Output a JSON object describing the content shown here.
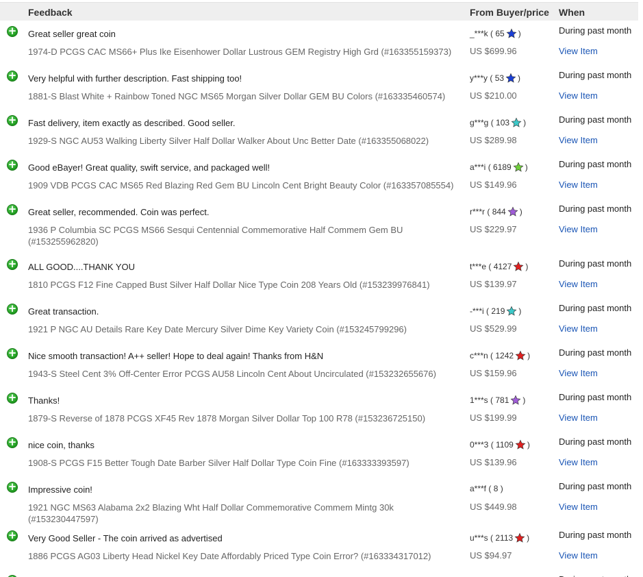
{
  "header": {
    "feedback": "Feedback",
    "buyer_price": "From Buyer/price",
    "when": "When"
  },
  "rows": [
    {
      "comment": "Great seller great coin",
      "item": "1974-D PCGS CAC MS66+ Plus Ike Eisenhower Dollar Lustrous GEM Registry High Grd (#163355159373)",
      "buyer": "_***k",
      "score": "65",
      "star_color": "#1a3fd6",
      "price": "US $699.96",
      "when": "During past month",
      "view": "View Item"
    },
    {
      "comment": "Very helpful with further description. Fast shipping too!",
      "item": "1881-S Blast White + Rainbow Toned NGC MS65 Morgan Silver Dollar GEM BU Colors (#163335460574)",
      "buyer": "y***y",
      "score": "53",
      "star_color": "#1a3fd6",
      "price": "US $210.00",
      "when": "During past month",
      "view": "View Item"
    },
    {
      "comment": "Fast delivery, item exactly as described. Good seller.",
      "item": "1929-S NGC AU53 Walking Liberty Silver Half Dollar Walker About Unc Better Date (#163355068022)",
      "buyer": "g***g",
      "score": "103",
      "star_color": "#3cc9c9",
      "price": "US $289.98",
      "when": "During past month",
      "view": "View Item"
    },
    {
      "comment": "Good eBayer! Great quality, swift service, and packaged well!",
      "item": "1909 VDB PCGS CAC MS65 Red Blazing Red Gem BU Lincoln Cent Bright Beauty Color (#163357085554)",
      "buyer": "a***i",
      "score": "6189",
      "star_color": "#6fcf3a",
      "price": "US $149.96",
      "when": "During past month",
      "view": "View Item"
    },
    {
      "comment": "Great seller, recommended. Coin was perfect.",
      "item": "1936 P Columbia SC PCGS MS66 Sesqui Centennial Commemorative Half Commem Gem BU (#153255962820)",
      "buyer": "r***r",
      "score": "844",
      "star_color": "#a05cd8",
      "price": "US $229.97",
      "when": "During past month",
      "view": "View Item"
    },
    {
      "comment": "ALL GOOD....THANK YOU",
      "item": "1810 PCGS F12 Fine Capped Bust Silver Half Dollar Nice Type Coin 208 Years Old (#153239976841)",
      "buyer": "t***e",
      "score": "4127",
      "star_color": "#e02020",
      "price": "US $139.97",
      "when": "During past month",
      "view": "View Item"
    },
    {
      "comment": "Great transaction.",
      "item": "1921 P NGC AU Details Rare Key Date Mercury Silver Dime Key Variety Coin (#153245799296)",
      "buyer": "-***i",
      "score": "219",
      "star_color": "#3cc9c9",
      "price": "US $529.99",
      "when": "During past month",
      "view": "View Item"
    },
    {
      "comment": "Nice smooth transaction! A++ seller! Hope to deal again! Thanks from H&N",
      "item": "1943-S Steel Cent 3% Off-Center Error PCGS AU58 Lincoln Cent About Uncirculated (#153232655676)",
      "buyer": "c***n",
      "score": "1242",
      "star_color": "#e02020",
      "price": "US $159.96",
      "when": "During past month",
      "view": "View Item"
    },
    {
      "comment": "Thanks!",
      "item": "1879-S Reverse of 1878 PCGS XF45 Rev 1878 Morgan Silver Dollar Top 100 R78 (#153236725150)",
      "buyer": "1***s",
      "score": "781",
      "star_color": "#a05cd8",
      "price": "US $199.99",
      "when": "During past month",
      "view": "View Item"
    },
    {
      "comment": "nice coin, thanks",
      "item": "1908-S PCGS F15 Better Tough Date Barber Silver Half Dollar Type Coin Fine (#163333393597)",
      "buyer": "0***3",
      "score": "1109",
      "star_color": "#e02020",
      "price": "US $139.96",
      "when": "During past month",
      "view": "View Item"
    },
    {
      "comment": "Impressive coin!",
      "item": "1921 NGC MS63 Alabama 2x2 Blazing Wht Half Dollar Commemorative Commem Mintg 30k (#153230447597)",
      "buyer": "a***f",
      "score": "8",
      "star_color": "",
      "price": "US $449.98",
      "when": "During past month",
      "view": "View Item"
    },
    {
      "comment": "Very Good Seller - The coin arrived as advertised",
      "item": "1886 PCGS AG03 Liberty Head Nickel Key Date Affordably Priced Type Coin Error? (#163334317012)",
      "buyer": "u***s",
      "score": "2113",
      "star_color": "#e02020",
      "price": "US $94.97",
      "when": "During past month",
      "view": "View Item"
    },
    {
      "comment": "",
      "item": "",
      "buyer": "",
      "score": "",
      "star_color": "",
      "price": "",
      "when": "During past month",
      "view": ""
    }
  ],
  "icons": {
    "positive": "positive-feedback-icon",
    "star": "feedback-star-icon"
  }
}
